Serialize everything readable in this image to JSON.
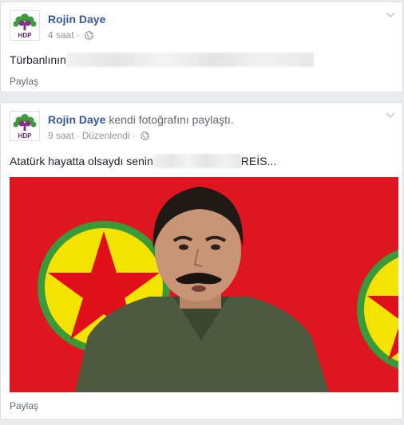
{
  "posts": [
    {
      "author": "Rojin Daye",
      "action": "",
      "time": "4 saat",
      "edited": "",
      "text_before": "Türbanlının",
      "text_after": "",
      "share_label": "Paylaş",
      "avatar_label": "HDP"
    },
    {
      "author": "Rojin Daye",
      "action": "kendi fotoğrafını paylaştı.",
      "time": "9 saat",
      "edited": "Düzenlendi",
      "text_before": "Atatürk hayatta olsaydı senin",
      "text_after": "REİS...",
      "share_label": "Paylaş",
      "avatar_label": "HDP"
    }
  ],
  "icons": {
    "globe": "globe-icon",
    "chevron": "chevron-down-icon",
    "avatar_logo": "hdp-tree-logo"
  },
  "colors": {
    "link": "#365899",
    "meta": "#90949c",
    "photo_background": "#e0101a",
    "emblem_green": "#3a9a3a",
    "emblem_yellow": "#f4e200",
    "emblem_star": "#e0101a"
  }
}
